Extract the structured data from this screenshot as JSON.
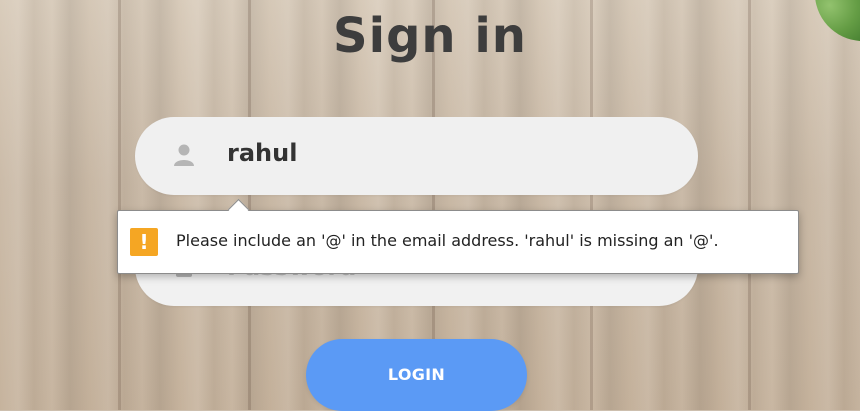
{
  "page": {
    "title": "Sign in"
  },
  "form": {
    "username": {
      "value": "rahul",
      "icon": "user-icon"
    },
    "password": {
      "placeholder": "Password",
      "icon": "lock-icon"
    },
    "login_label": "LOGIN"
  },
  "validation": {
    "message": "Please include an '@' in the email address. 'rahul' is missing an '@'.",
    "icon": "warning-icon",
    "icon_glyph": "!"
  },
  "colors": {
    "primary_button": "#5b9af5",
    "warning": "#f5a623",
    "title_text": "#3d3d3d"
  }
}
